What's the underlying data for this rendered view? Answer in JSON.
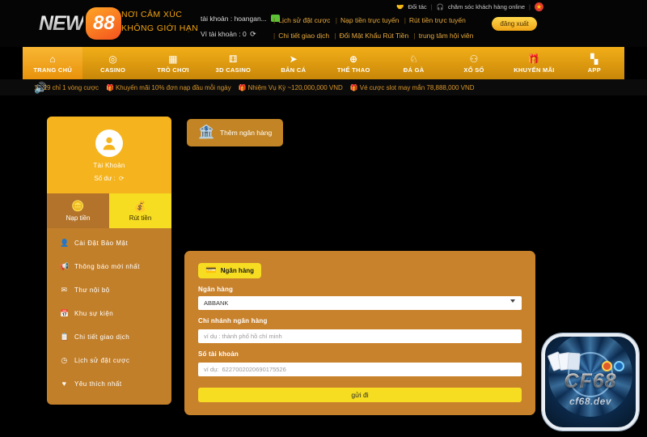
{
  "header": {
    "logo_new": "NEW",
    "logo_88": "88",
    "slogan_line1": "NƠI CẢM XÚC",
    "slogan_line2": "KHÔNG GIỚI HẠN",
    "account_label": "tài khoản : hoangan...",
    "wallet_label": "Ví tài khoản : 0",
    "refresh_icon": "refresh-icon",
    "message_icon": "message-icon",
    "top_links": [
      "Lịch sử đặt cược",
      "Nạp tiền trực tuyến",
      "Rút tiền trực tuyến",
      "Chi tiết giao dịch",
      "Đổi Mật Khẩu Rút Tiền",
      "trung tâm hội viên"
    ],
    "partner_label": "Đối tác",
    "partner_icon": "handshake-icon",
    "support_label": "chăm sóc khách hàng online",
    "support_icon": "headset-icon",
    "flag_icon": "vietnam-flag-icon",
    "logout_label": "đăng xuất",
    "separator": "|"
  },
  "nav": {
    "items": [
      {
        "label": "TRANG CHỦ",
        "icon": "home-icon",
        "glyph": "⌂",
        "active": true
      },
      {
        "label": "CASINO",
        "icon": "casino-chip-icon",
        "glyph": "◎",
        "active": false
      },
      {
        "label": "TRÒ CHƠI",
        "icon": "slot-machine-icon",
        "glyph": "▦",
        "active": false
      },
      {
        "label": "3D CASINO",
        "icon": "dice-icon",
        "glyph": "⚅",
        "active": false
      },
      {
        "label": "BẮN CÁ",
        "icon": "fish-icon",
        "glyph": "🐟",
        "active": false
      },
      {
        "label": "THỂ THAO",
        "icon": "football-icon",
        "glyph": "⚽",
        "active": false
      },
      {
        "label": "ĐÁ GÀ",
        "icon": "rooster-icon",
        "glyph": "🐓",
        "active": false
      },
      {
        "label": "XỔ SỐ",
        "icon": "lottery-balls-icon",
        "glyph": "⚇",
        "active": false
      },
      {
        "label": "KHUYẾN MÃI",
        "icon": "gift-icon",
        "glyph": "🎁",
        "active": false
      },
      {
        "label": "APP",
        "icon": "grid-apps-icon",
        "glyph": "▞",
        "active": false
      }
    ]
  },
  "ticker": {
    "speaker_icon": "speaker-icon",
    "items": [
      "19-29 chỉ 1 vòng cược",
      "Khuyến mãi 10% đơn nạp đầu mỗi ngày",
      "Nhiệm Vụ Kỳ ~120,000,000 VND",
      "Vé cược slot may mắn 78,888,000 VND"
    ]
  },
  "sidebar": {
    "avatar_icon": "user-avatar-icon",
    "profile_name": "Tài Khoản",
    "balance_label": "Số dư :",
    "balance_refresh_icon": "refresh-icon",
    "tabs": [
      {
        "label": "Nạp tiền",
        "icon": "deposit-coin-icon",
        "glyph": "⊙",
        "active": false
      },
      {
        "label": "Rút tiền",
        "icon": "withdraw-hand-icon",
        "glyph": "✋",
        "active": true
      }
    ],
    "menu": [
      {
        "label": "Cài Đặt Bảo Mật",
        "icon": "user-shield-icon",
        "glyph": "●"
      },
      {
        "label": "Thông báo mới nhất",
        "icon": "megaphone-icon",
        "glyph": "◤"
      },
      {
        "label": "Thư nội bộ",
        "icon": "envelope-icon",
        "glyph": "✉"
      },
      {
        "label": "Khu sự kiện",
        "icon": "calendar-icon",
        "glyph": "▤"
      },
      {
        "label": "Chi tiết giao dịch",
        "icon": "clipboard-icon",
        "glyph": "▯"
      },
      {
        "label": "Lịch sử đặt cược",
        "icon": "clock-icon",
        "glyph": "◷"
      },
      {
        "label": "Yêu thích nhất",
        "icon": "heart-icon",
        "glyph": "♥"
      }
    ]
  },
  "main": {
    "add_bank_label": "Thêm ngân hàng",
    "add_bank_icon": "bank-plus-icon",
    "pill_label": "Ngân hàng",
    "pill_icon": "credit-card-icon",
    "fields": {
      "bank_label": "Ngân hàng",
      "bank_value": "ABBANK",
      "branch_label": "Chi nhánh ngân hàng",
      "branch_value": "",
      "branch_placeholder": "ví dụ : thành phố hồ chí minh",
      "account_label": "Số tài khoản",
      "account_value": "",
      "account_placeholder": "ví dụ:  6227002020690175526"
    },
    "submit_label": "gửi đi"
  },
  "watermark": {
    "title": "CF68",
    "subtitle": "cf68.dev"
  },
  "colors": {
    "brand_yellow": "#f5b31d",
    "bright_yellow": "#f7dd22",
    "panel_orange": "#c9822c",
    "dark_orange": "#b3732a",
    "background": "#000000",
    "ticker_text": "#d9962a"
  }
}
